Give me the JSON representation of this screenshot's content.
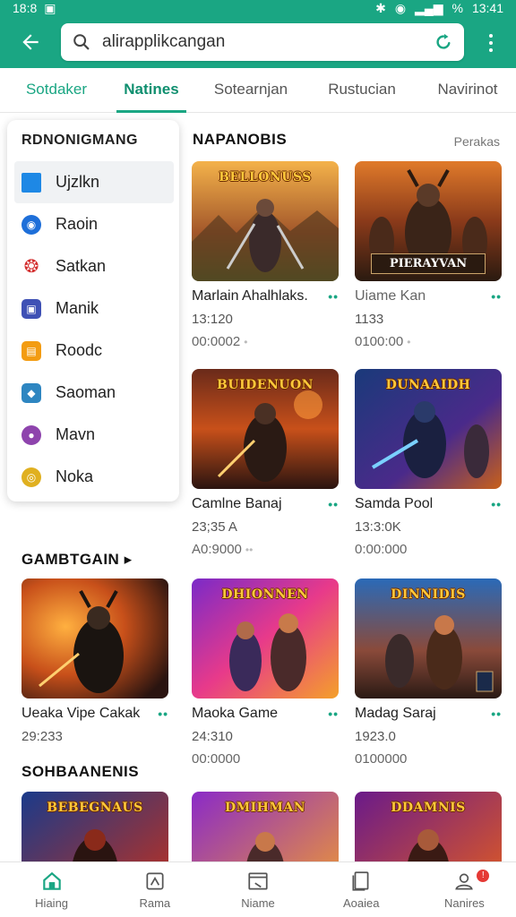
{
  "status_bar": {
    "left_time": "18:8",
    "right_time": "13:41",
    "signal_text": "%"
  },
  "search": {
    "query": "alirapplikcangan",
    "icon": "search-icon"
  },
  "tabs": [
    {
      "label": "Sotdaker"
    },
    {
      "label": "Natines"
    },
    {
      "label": "Sotearnjan"
    },
    {
      "label": "Rustucian"
    },
    {
      "label": "Navirinot"
    }
  ],
  "dropdown": {
    "header": "RDNONIGMANG",
    "items": [
      {
        "label": "Ujzlkn",
        "color": "#1e88e5"
      },
      {
        "label": "Raoin",
        "color": "#1e6fd9"
      },
      {
        "label": "Satkan",
        "color": "#d32f2f"
      },
      {
        "label": "Manik",
        "color": "#3f51b5"
      },
      {
        "label": "Roodc",
        "color": "#f39c12"
      },
      {
        "label": "Saoman",
        "color": "#2e86c1"
      },
      {
        "label": "Mavn",
        "color": "#8e44ad"
      },
      {
        "label": "Noka",
        "color": "#e0b020"
      }
    ]
  },
  "sections": {
    "s1": {
      "title": "NAPANOBIS",
      "see_all": "Perakas"
    },
    "s2": {
      "title": "GAMBTGAIN"
    },
    "s3": {
      "title": "SOHBAANENIS"
    }
  },
  "cards": [
    {
      "title": "Marlain Ahalhlaks.",
      "meta1": "13:120",
      "meta2": "00:0002",
      "logo": "BELLONUSS",
      "banner": ""
    },
    {
      "title": "Uiame Kan",
      "meta1": "1133",
      "meta2": "0100:00",
      "logo": "",
      "banner": "PIERAYVAN"
    },
    {
      "title": "Camlne Banaj",
      "meta1": "23;35 A",
      "meta2": "A0:9000",
      "logo": "BUIDENUON",
      "banner": ""
    },
    {
      "title": "Samda Pool",
      "meta1": "13:3:0K",
      "meta2": "0:00:000",
      "logo": "DUNAAIDH",
      "banner": ""
    },
    {
      "title": "Ueaka Vipe Cakak",
      "meta1": "29:233",
      "meta2": "",
      "logo": "",
      "banner": ""
    },
    {
      "title": "Maoka Game",
      "meta1": "24:310",
      "meta2": "00:0000",
      "logo": "DHIONNEN",
      "banner": ""
    },
    {
      "title": "Madag Saraj",
      "meta1": "1923.0",
      "meta2": "0100000",
      "logo": "DINNIDIS",
      "banner": ""
    },
    {
      "title": "",
      "meta1": "",
      "meta2": "",
      "logo": "BEBEGNAUS",
      "banner": ""
    },
    {
      "title": "",
      "meta1": "",
      "meta2": "",
      "logo": "DMIHMAN",
      "banner": ""
    },
    {
      "title": "",
      "meta1": "",
      "meta2": "",
      "logo": "DDAMNIS",
      "banner": ""
    }
  ],
  "bottom_nav": [
    {
      "label": "Hiaing",
      "icon": "home-icon"
    },
    {
      "label": "Rama",
      "icon": "apps-icon"
    },
    {
      "label": "Niame",
      "icon": "games-icon"
    },
    {
      "label": "Aoaiea",
      "icon": "library-icon"
    },
    {
      "label": "Nanires",
      "icon": "profile-icon",
      "badge": "!"
    }
  ],
  "colors": {
    "accent": "#1aa683",
    "badge": "#e53935"
  }
}
